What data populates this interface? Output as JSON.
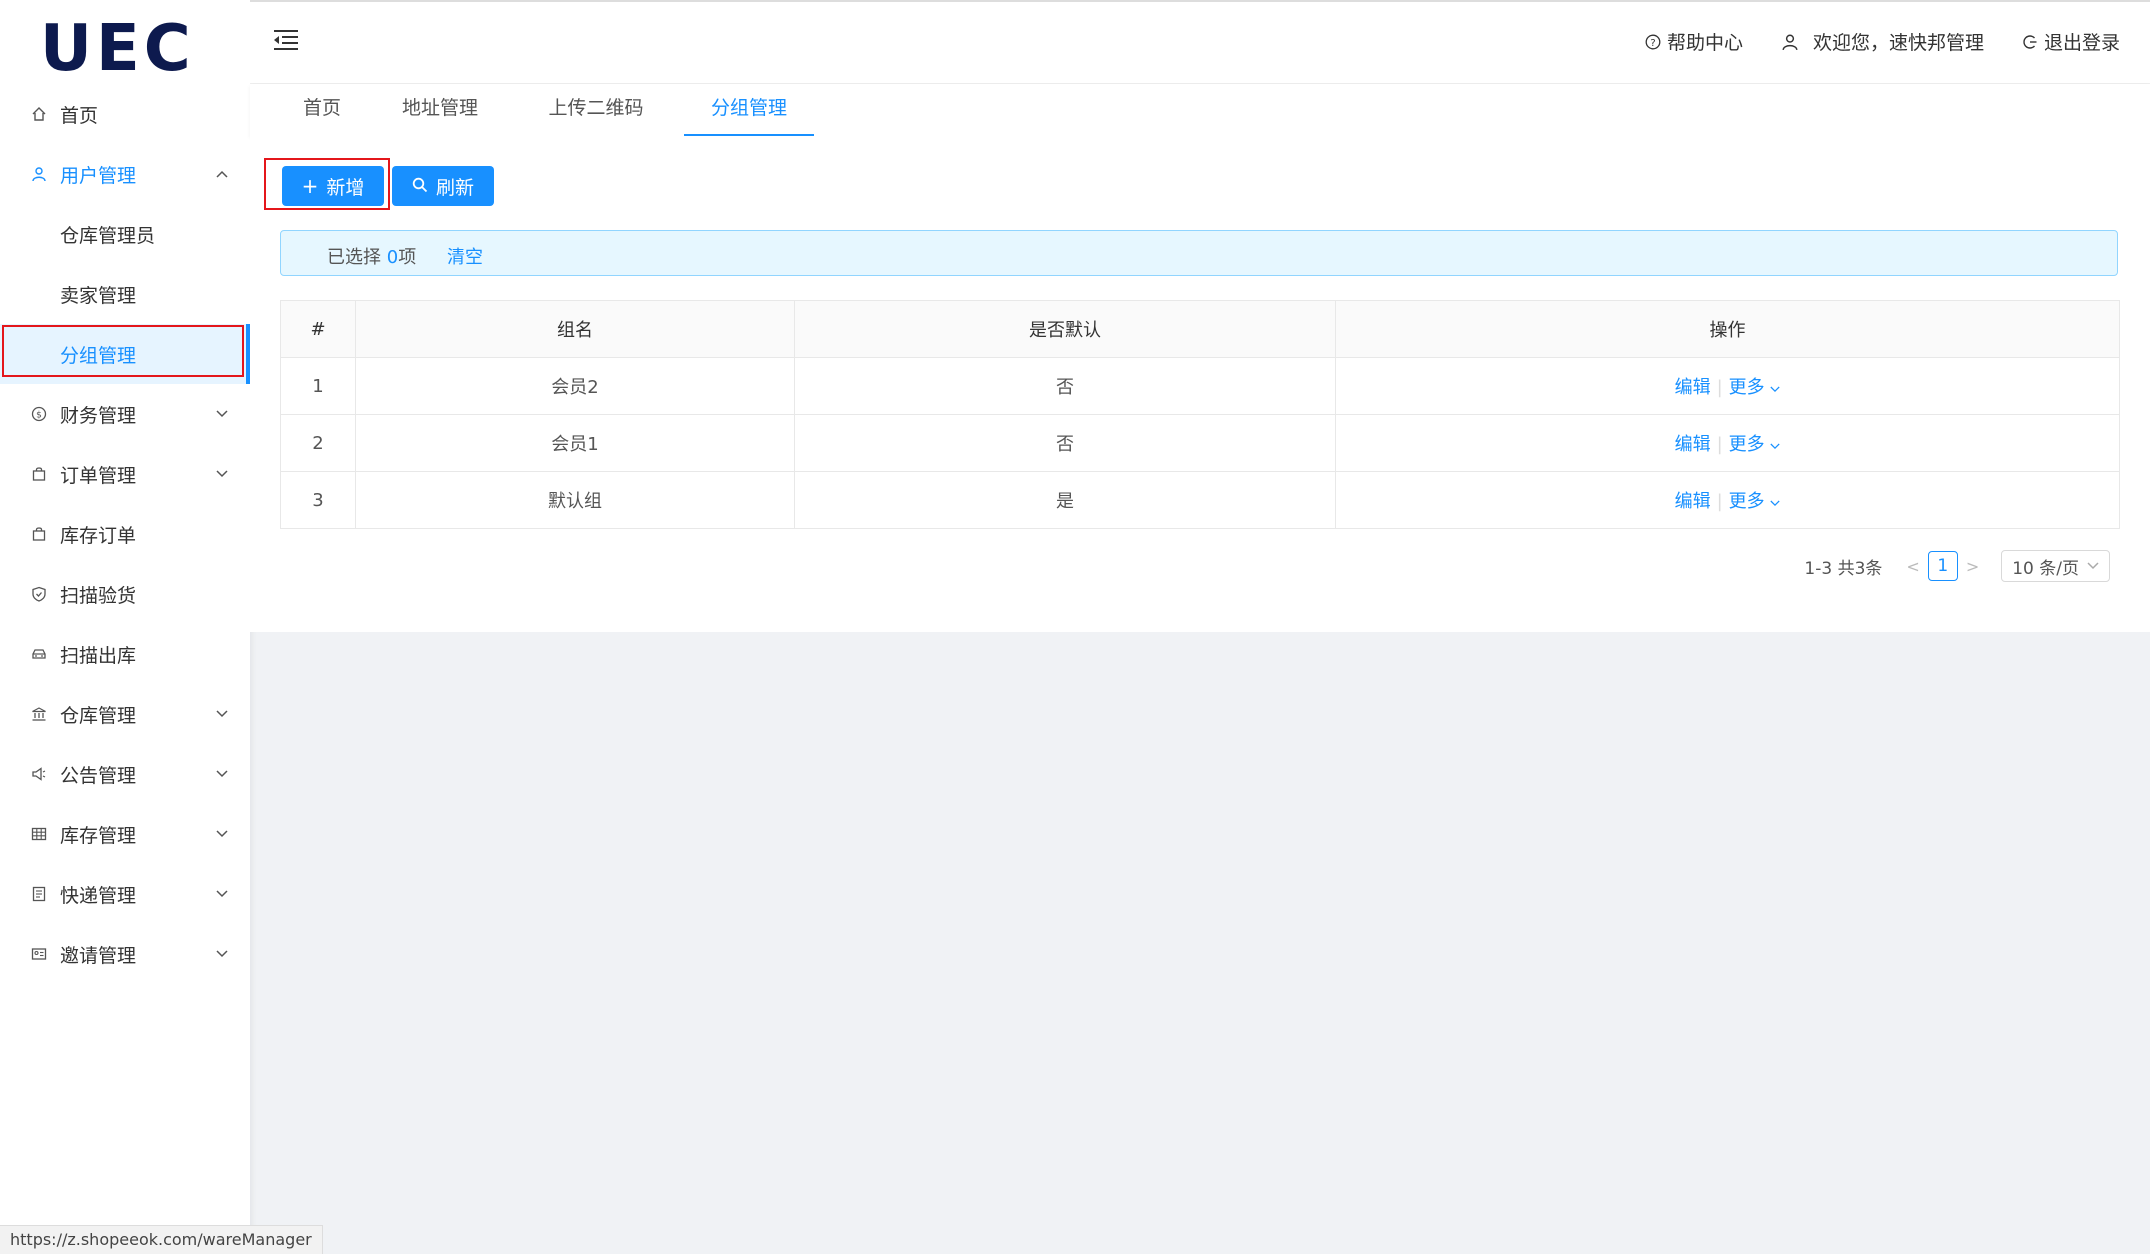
{
  "logo": "UEC",
  "sidebar": {
    "items": [
      {
        "label": "首页",
        "icon": "home-icon"
      },
      {
        "label": "用户管理",
        "icon": "user-icon"
      },
      {
        "label": "仓库管理员"
      },
      {
        "label": "卖家管理"
      },
      {
        "label": "分组管理"
      },
      {
        "label": "财务管理",
        "icon": "dollar-icon"
      },
      {
        "label": "订单管理",
        "icon": "shopping-bag-icon"
      },
      {
        "label": "库存订单",
        "icon": "shopping-bag-icon"
      },
      {
        "label": "扫描验货",
        "icon": "shield-icon"
      },
      {
        "label": "扫描出库",
        "icon": "car-icon"
      },
      {
        "label": "仓库管理",
        "icon": "bank-icon"
      },
      {
        "label": "公告管理",
        "icon": "notification-icon"
      },
      {
        "label": "库存管理",
        "icon": "table-icon"
      },
      {
        "label": "快递管理",
        "icon": "profile-icon"
      },
      {
        "label": "邀请管理",
        "icon": "idcard-icon"
      }
    ]
  },
  "header": {
    "help": "帮助中心",
    "welcome": "欢迎您，速快邦管理",
    "logout": "退出登录"
  },
  "tabs": [
    "首页",
    "地址管理",
    "上传二维码",
    "分组管理"
  ],
  "toolbar": {
    "add_label": "新增",
    "refresh_label": "刷新"
  },
  "alert": {
    "prefix": "已选择 ",
    "count": "0",
    "suffix": "项",
    "clear": "清空"
  },
  "table": {
    "headers": [
      "#",
      "组名",
      "是否默认",
      "操作"
    ],
    "rows": [
      {
        "index": "1",
        "name": "会员2",
        "is_default": "否"
      },
      {
        "index": "2",
        "name": "会员1",
        "is_default": "否"
      },
      {
        "index": "3",
        "name": "默认组",
        "is_default": "是"
      }
    ],
    "edit_label": "编辑",
    "more_label": "更多"
  },
  "pagination": {
    "total_text": "1-3 共3条",
    "current": "1",
    "page_size": "10 条/页"
  },
  "status_url": "https://z.shopeeok.com/wareManager",
  "colors": {
    "primary": "#1890ff",
    "highlight": "#e4161b",
    "logo": "#0d1a4e"
  }
}
